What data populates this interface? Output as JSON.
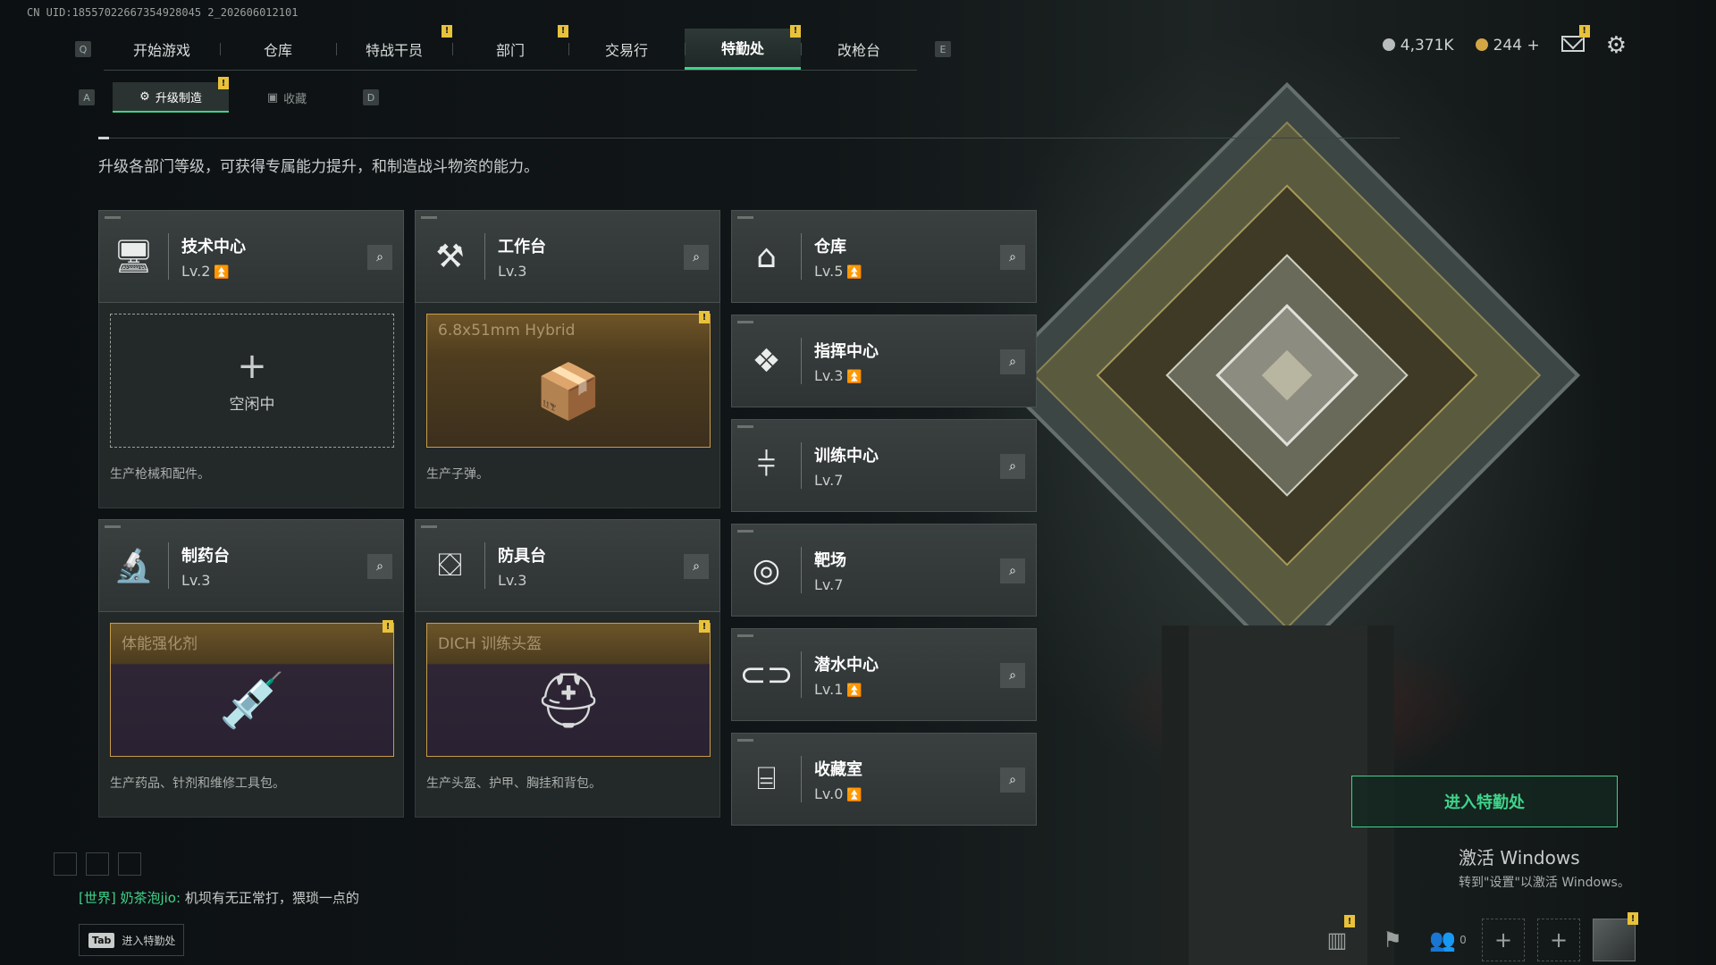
{
  "uid": "CN UID:18557022667354928045 2_202606012101",
  "nav": {
    "key_left": "Q",
    "key_right": "E",
    "tabs": [
      {
        "label": "开始游戏",
        "alert": false,
        "active": false
      },
      {
        "label": "仓库",
        "alert": false,
        "active": false
      },
      {
        "label": "特战干员",
        "alert": true,
        "active": false
      },
      {
        "label": "部门",
        "alert": true,
        "active": false
      },
      {
        "label": "交易行",
        "alert": false,
        "active": false
      },
      {
        "label": "特勤处",
        "alert": true,
        "active": true
      },
      {
        "label": "改枪台",
        "alert": false,
        "active": false
      }
    ]
  },
  "currency": {
    "silver": "4,371K",
    "gold": "244",
    "gold_add": "+"
  },
  "subnav": {
    "key_left": "A",
    "key_right": "D",
    "tabs": [
      {
        "label": "升级制造",
        "active": true
      },
      {
        "label": "收藏",
        "active": false
      }
    ]
  },
  "alert_mark": "!",
  "intro": "升级各部门等级，可获得专属能力提升，和制造战斗物资的能力。",
  "workshops": [
    {
      "name": "技术中心",
      "level": "Lv.2",
      "upgrade": true,
      "icon": "monitor-icon",
      "slot": "idle",
      "slot_label": "空闲中",
      "desc": "生产枪械和配件。"
    },
    {
      "name": "工作台",
      "level": "Lv.3",
      "upgrade": false,
      "icon": "tools-icon",
      "slot": "item",
      "item": "6.8x51mm Hybrid",
      "desc": "生产子弹。"
    },
    {
      "name": "制药台",
      "level": "Lv.3",
      "upgrade": false,
      "icon": "microscope-icon",
      "slot": "item",
      "item": "体能强化剂",
      "desc": "生产药品、针剂和维修工具包。"
    },
    {
      "name": "防具台",
      "level": "Lv.3",
      "upgrade": false,
      "icon": "armor-icon",
      "slot": "item",
      "item": "DICH 训练头盔",
      "desc": "生产头盔、护甲、胸挂和背包。"
    }
  ],
  "facilities": [
    {
      "name": "仓库",
      "level": "Lv.5",
      "upgrade": true,
      "icon": "warehouse-icon"
    },
    {
      "name": "指挥中心",
      "level": "Lv.3",
      "upgrade": true,
      "icon": "command-icon"
    },
    {
      "name": "训练中心",
      "level": "Lv.7",
      "upgrade": false,
      "icon": "dumbbell-icon"
    },
    {
      "name": "靶场",
      "level": "Lv.7",
      "upgrade": false,
      "icon": "target-icon"
    },
    {
      "name": "潜水中心",
      "level": "Lv.1",
      "upgrade": true,
      "icon": "diving-mask-icon"
    },
    {
      "name": "收藏室",
      "level": "Lv.0",
      "upgrade": true,
      "icon": "collection-icon"
    }
  ],
  "enter_button": "进入特勤处",
  "windows_activation": {
    "title": "激活 Windows",
    "subtitle": "转到\"设置\"以激活 Windows。"
  },
  "chat": {
    "channel": "[世界] 奶茶泡jio:",
    "message": "机坝有无正常打，猥琐一点的"
  },
  "tab_hint": {
    "key": "Tab",
    "label": "进入特勤处"
  },
  "friends_count": "0",
  "colors": {
    "accent": "#3fd38a",
    "alert": "#e8c23a",
    "gold_border": "#c89b4a"
  }
}
